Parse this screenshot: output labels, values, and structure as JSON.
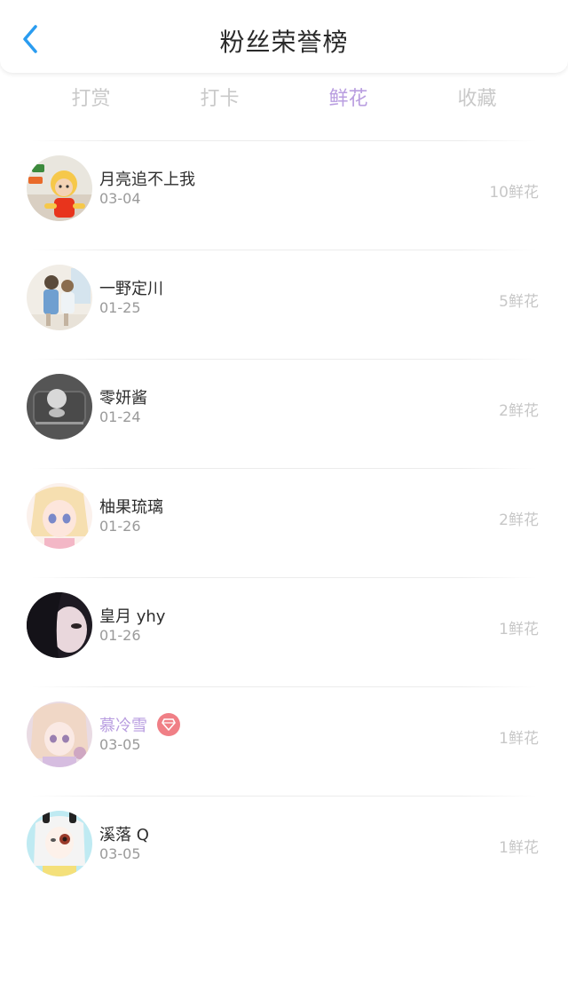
{
  "header": {
    "title": "粉丝荣誉榜",
    "back_icon": "chevron-left-icon",
    "accent_color": "#2a9cf0"
  },
  "tabs": [
    {
      "label": "打赏",
      "active": false
    },
    {
      "label": "打卡",
      "active": false
    },
    {
      "label": "鲜花",
      "active": true
    },
    {
      "label": "收藏",
      "active": false
    }
  ],
  "active_tab_color": "#b99ee0",
  "fans": [
    {
      "name": "月亮追不上我",
      "date": "03-04",
      "count": "10鲜花",
      "vip": false
    },
    {
      "name": "一野定川",
      "date": "01-25",
      "count": "5鲜花",
      "vip": false
    },
    {
      "name": "零妍酱",
      "date": "01-24",
      "count": "2鲜花",
      "vip": false
    },
    {
      "name": "柚果琉璃",
      "date": "01-26",
      "count": "2鲜花",
      "vip": false
    },
    {
      "name": "皇月 yhy",
      "date": "01-26",
      "count": "1鲜花",
      "vip": false
    },
    {
      "name": "慕冷雪",
      "date": "03-05",
      "count": "1鲜花",
      "vip": true,
      "badge_icon": "diamond-icon",
      "badge_color": "#f07f86"
    },
    {
      "name": "溪落 Q",
      "date": "03-05",
      "count": "1鲜花",
      "vip": false
    }
  ]
}
